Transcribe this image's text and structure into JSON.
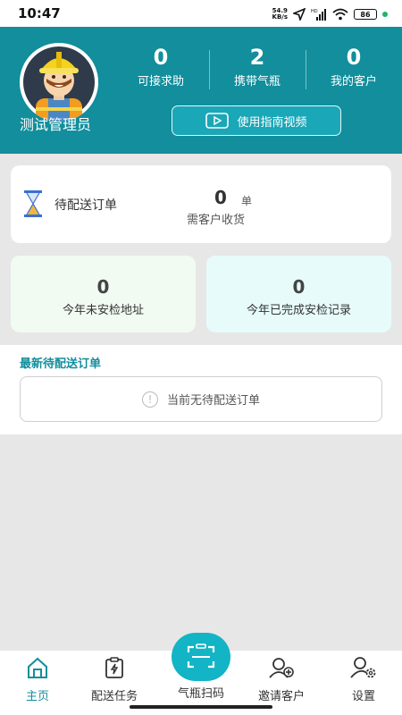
{
  "status_bar": {
    "time": "10:47",
    "net_speed_value": "54.9",
    "net_speed_unit": "KB/s",
    "battery": "86"
  },
  "header": {
    "user_name": "测试管理员",
    "stats": [
      {
        "value": "0",
        "label": "可接求助"
      },
      {
        "value": "2",
        "label": "携带气瓶"
      },
      {
        "value": "0",
        "label": "我的客户"
      }
    ],
    "guide_button_label": "使用指南视频"
  },
  "pending_card": {
    "label": "待配送订单",
    "count": "0",
    "unit": "单",
    "subtitle": "需客户收货"
  },
  "summary_boxes": [
    {
      "value": "0",
      "label": "今年未安检地址"
    },
    {
      "value": "0",
      "label": "今年已完成安检记录"
    }
  ],
  "latest_orders": {
    "title": "最新待配送订单",
    "empty_text": "当前无待配送订单"
  },
  "bottom_nav": {
    "items": [
      {
        "label": "主页",
        "icon": "home-icon",
        "active": true
      },
      {
        "label": "配送任务",
        "icon": "delivery-task-icon",
        "active": false
      },
      {
        "label": "气瓶扫码",
        "icon": "scan-icon",
        "active": false
      },
      {
        "label": "邀请客户",
        "icon": "invite-customer-icon",
        "active": false
      },
      {
        "label": "设置",
        "icon": "settings-icon",
        "active": false
      }
    ]
  },
  "colors": {
    "brand_teal": "#128e9c",
    "scan_button": "#12b4c5",
    "box_left_bg": "#f1fbf1",
    "box_right_bg": "#e7fbfb"
  }
}
